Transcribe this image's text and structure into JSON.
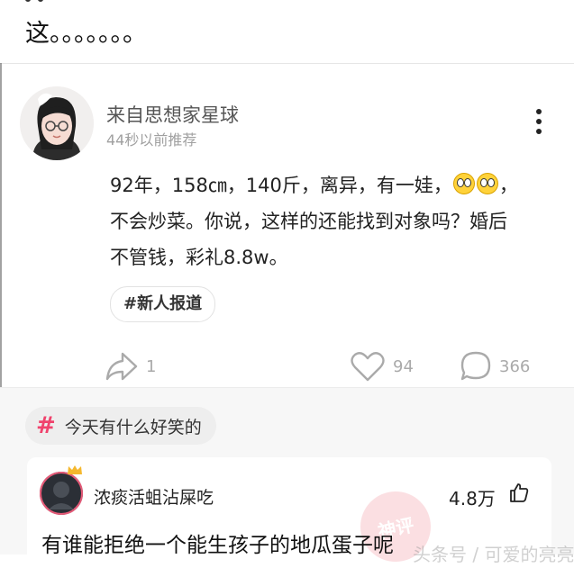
{
  "previous_post": {
    "caption": "这。。。。。。。"
  },
  "post": {
    "author": "来自思想家星球",
    "time": "44秒以前推荐",
    "lines": [
      "92年，158㎝，140斤，离异，有一娃，",
      "不会炒菜。你说，这样的还能找到对象吗？婚后",
      "不管钱，彩礼8.8w。"
    ],
    "line1_suffix": "，",
    "emoji": "pleading-face",
    "tag": "#新人报道",
    "share_count": "1",
    "like_count": "94",
    "comment_count": "366"
  },
  "comments": {
    "topic": "今天有什么好笑的",
    "top_comment": {
      "user": "浓痰活蛆沾屎吃",
      "likes": "4.8万",
      "text": "有谁能拒绝一个能生孩子的地瓜蛋子呢",
      "seal_text": "神评"
    }
  },
  "watermark": "头条号 / 可爱的亮亮",
  "colors": {
    "accent": "#f0436d",
    "muted": "#aaaaaa"
  }
}
